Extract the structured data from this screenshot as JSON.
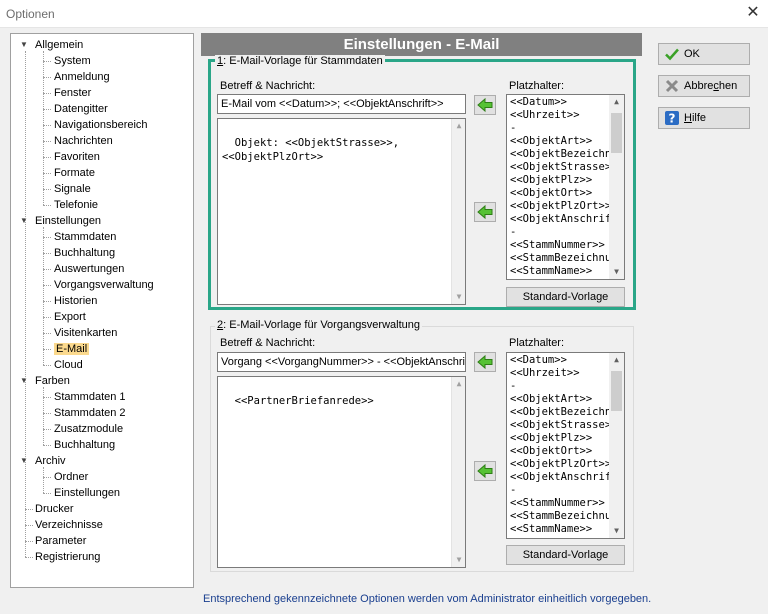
{
  "window": {
    "title": "Optionen",
    "close_glyph": "✕"
  },
  "tree": [
    {
      "label": "Allgemein",
      "level": 0,
      "expanded": true
    },
    {
      "label": "System",
      "level": 1
    },
    {
      "label": "Anmeldung",
      "level": 1
    },
    {
      "label": "Fenster",
      "level": 1
    },
    {
      "label": "Datengitter",
      "level": 1
    },
    {
      "label": "Navigationsbereich",
      "level": 1
    },
    {
      "label": "Nachrichten",
      "level": 1
    },
    {
      "label": "Favoriten",
      "level": 1
    },
    {
      "label": "Formate",
      "level": 1
    },
    {
      "label": "Signale",
      "level": 1
    },
    {
      "label": "Telefonie",
      "level": 1
    },
    {
      "label": "Einstellungen",
      "level": 0,
      "expanded": true
    },
    {
      "label": "Stammdaten",
      "level": 1
    },
    {
      "label": "Buchhaltung",
      "level": 1
    },
    {
      "label": "Auswertungen",
      "level": 1
    },
    {
      "label": "Vorgangsverwaltung",
      "level": 1
    },
    {
      "label": "Historien",
      "level": 1
    },
    {
      "label": "Export",
      "level": 1
    },
    {
      "label": "Visitenkarten",
      "level": 1
    },
    {
      "label": "E-Mail",
      "level": 1,
      "selected": true
    },
    {
      "label": "Cloud",
      "level": 1
    },
    {
      "label": "Farben",
      "level": 0,
      "expanded": true
    },
    {
      "label": "Stammdaten 1",
      "level": 1
    },
    {
      "label": "Stammdaten 2",
      "level": 1
    },
    {
      "label": "Zusatzmodule",
      "level": 1
    },
    {
      "label": "Buchhaltung",
      "level": 1
    },
    {
      "label": "Archiv",
      "level": 0,
      "expanded": true
    },
    {
      "label": "Ordner",
      "level": 1
    },
    {
      "label": "Einstellungen",
      "level": 1
    },
    {
      "label": "Drucker",
      "level": 0
    },
    {
      "label": "Verzeichnisse",
      "level": 0
    },
    {
      "label": "Parameter",
      "level": 0
    },
    {
      "label": "Registrierung",
      "level": 0
    }
  ],
  "header": {
    "title": "Einstellungen - E-Mail"
  },
  "group1": {
    "legend_num": "1",
    "legend_rest": ": E-Mail-Vorlage für Stammdaten",
    "subject_label": "Betreff & Nachricht:",
    "subject_value": "E-Mail vom <<Datum>>; <<ObjektAnschrift>>",
    "body_value": "Objekt: <<ObjektStrasse>>,\n<<ObjektPlzOrt>>",
    "placeholder_label": "Platzhalter:",
    "placeholders": "<<Datum>>\n<<Uhrzeit>>\n-\n<<ObjektArt>>\n<<ObjektBezeichnur\n<<ObjektStrasse>>\n<<ObjektPlz>>\n<<ObjektOrt>>\n<<ObjektPlzOrt>>\n<<ObjektAnschrift>>\n-\n<<StammNummer>>\n<<StammBezeichnur\n<<StammName>>",
    "std_button": "Standard-Vorlage"
  },
  "group2": {
    "legend_num": "2",
    "legend_rest": ": E-Mail-Vorlage für Vorgangsverwaltung",
    "subject_label": "Betreff & Nachricht:",
    "subject_value": "Vorgang <<VorgangNummer>> - <<ObjektAnschrift>>",
    "body_value": "<<PartnerBriefanrede>>",
    "placeholder_label": "Platzhalter:",
    "placeholders": "<<Datum>>\n<<Uhrzeit>>\n-\n<<ObjektArt>>\n<<ObjektBezeichnur\n<<ObjektStrasse>>\n<<ObjektPlz>>\n<<ObjektOrt>>\n<<ObjektPlzOrt>>\n<<ObjektAnschrift>>\n-\n<<StammNummer>>\n<<StammBezeichnur\n<<StammName>>",
    "std_button": "Standard-Vorlage"
  },
  "buttons": {
    "ok": "OK",
    "cancel_pre": "Abbre",
    "cancel_u": "c",
    "cancel_post": "hen",
    "help_u": "H",
    "help_post": "ilfe"
  },
  "footer": "Entsprechend gekennzeichnete Optionen werden vom Administrator einheitlich vorgegeben.",
  "colors": {
    "highlight": "#2aa688",
    "selected": "#fbd98d",
    "header_bg": "#808080",
    "footer_text": "#1a3f8f"
  }
}
